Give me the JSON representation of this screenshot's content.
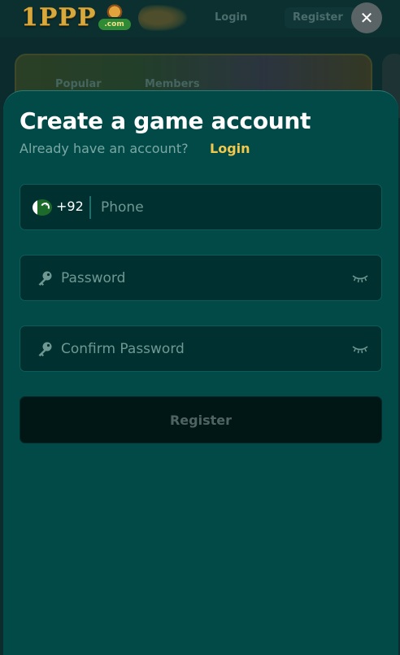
{
  "header": {
    "logo_text": "1PPP",
    "logo_badge": ".com",
    "nav_login": "Login",
    "nav_register": "Register",
    "close_glyph": "✕"
  },
  "background": {
    "tab_1": "Popular",
    "tab_2": "Members"
  },
  "modal": {
    "title": "Create a game account",
    "subtitle": "Already have an account?",
    "login_link": "Login",
    "phone": {
      "country_flag": "pakistan-flag-icon",
      "country_code": "+92",
      "placeholder": "Phone",
      "value": ""
    },
    "password": {
      "icon": "key-icon",
      "placeholder": "Password",
      "value": "",
      "toggle_icon": "eye-closed-icon"
    },
    "confirm_password": {
      "icon": "key-icon",
      "placeholder": "Confirm Password",
      "value": "",
      "toggle_icon": "eye-closed-icon"
    },
    "register_label": "Register"
  },
  "colors": {
    "sheet_bg": "#024a48",
    "field_bg": "#00302f",
    "accent_link": "#f2c84b",
    "button_bg": "#011716"
  }
}
